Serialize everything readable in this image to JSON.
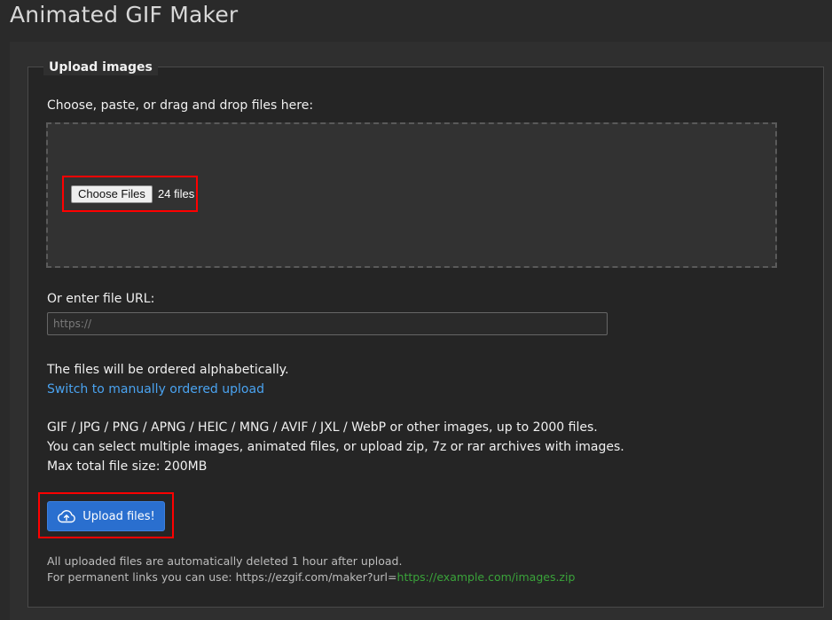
{
  "page": {
    "title": "Animated GIF Maker"
  },
  "upload": {
    "legend": "Upload images",
    "choose_label": "Choose, paste, or drag and drop files here:",
    "choose_button": "Choose Files",
    "file_count": "24 files",
    "url_label": "Or enter file URL:",
    "url_placeholder": "https://",
    "url_value": "",
    "order_note": "The files will be ordered alphabetically.",
    "switch_link": "Switch to manually ordered upload",
    "formats_line": "GIF / JPG / PNG / APNG / HEIC / MNG / AVIF / JXL / WebP or other images, up to 2000 files.",
    "multi_line": "You can select multiple images, animated files, or upload zip, 7z or rar archives with images.",
    "max_size_line": "Max total file size: 200MB",
    "upload_button": "Upload files!",
    "deleted_note": "All uploaded files are automatically deleted 1 hour after upload.",
    "permalink_prefix": "For permanent links you can use: https://ezgif.com/maker?url=",
    "permalink_example": "https://example.com/images.zip"
  },
  "icons": {
    "upload": "cloud-upload-icon"
  },
  "colors": {
    "background": "#2a2a2a",
    "panel": "#2f2f2f",
    "accent_link": "#4aa3f0",
    "button_primary": "#2a6fcf",
    "highlight_box": "#ff0000",
    "example_link": "#3aa33a"
  }
}
